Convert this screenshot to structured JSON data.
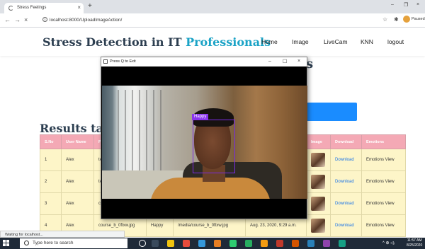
{
  "browser": {
    "tab_title": "Stress Feelings",
    "tab_close": "×",
    "new_tab": "+",
    "url": "localhost:8000/UploadImageAction/",
    "back": "←",
    "forward": "→",
    "reload": "×",
    "info": "i",
    "profile_status": "Paused",
    "minimize": "–",
    "maximize": "❐",
    "close": "×",
    "star": "☆",
    "extensions": "✱"
  },
  "site": {
    "brand_main": "Stress Detection in IT ",
    "brand_accent": "Professionals",
    "nav": [
      "Home",
      "Image",
      "LiveCam",
      "KNN",
      "logout"
    ]
  },
  "results": {
    "title": "Results tab",
    "headers": [
      "S.No",
      "User Name",
      "Fi",
      "",
      "",
      "",
      "Image",
      "Download",
      "Emotions"
    ],
    "rows": [
      {
        "sno": "1",
        "user": "Alex",
        "file": "te",
        "emotion": "",
        "file2": "",
        "date": "",
        "download": "Download",
        "emotions": "Emotions View"
      },
      {
        "sno": "2",
        "user": "Alex",
        "file": "te",
        "emotion": "",
        "file2": "",
        "date": "",
        "download": "Download",
        "emotions": "Emotions View"
      },
      {
        "sno": "3",
        "user": "Alex",
        "file": "co",
        "emotion": "",
        "file2": "",
        "date": "",
        "download": "Download",
        "emotions": "Emotions View"
      },
      {
        "sno": "4",
        "user": "Alex",
        "file": "course_b_0ftxw.jpg",
        "emotion": "Happy",
        "file2": "/media/course_b_0ftxw.jpg",
        "date": "Aug. 23, 2020, 9:29 a.m.",
        "download": "Download",
        "emotions": "Emotions View"
      }
    ]
  },
  "cv_window": {
    "title": "Press Q to Exit",
    "minimize": "–",
    "maximize": "☐",
    "close": "×",
    "face_label": "Happy"
  },
  "status": "Waiting for localhost...",
  "taskbar": {
    "search_placeholder": "Type here to search",
    "tray": "^ ⊕ ◁ᵢ",
    "time": "11:57 AM",
    "date": "8/25/2020"
  },
  "colors": {
    "brand": "#2c3e50",
    "accent": "#1ba3c6",
    "table_header": "#f4a9b5",
    "table_row": "#fdf5c8",
    "face_box": "#7a2be2",
    "primary_button": "#1a8cff"
  }
}
